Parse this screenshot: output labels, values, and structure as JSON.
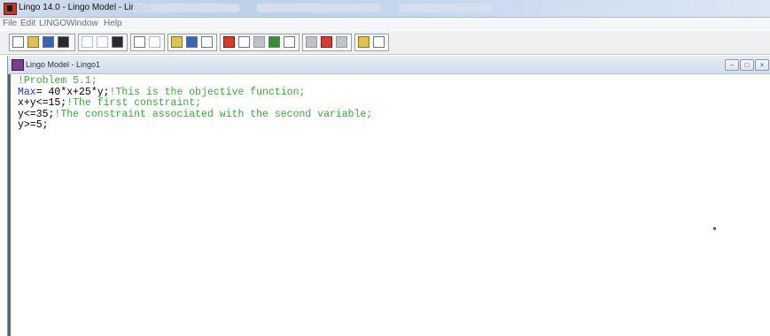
{
  "window": {
    "title": "Lingo 14.0 - Lingo Model - Lingo1"
  },
  "menu": [
    "File",
    "Edit",
    "LINGO",
    "Window",
    "Help"
  ],
  "toolbar": {
    "icons": [
      "new-icon",
      "open-icon",
      "save-icon",
      "print-icon",
      "cut-icon",
      "copy-icon",
      "paste-icon",
      "undo-icon",
      "redo-icon",
      "find-icon",
      "goto-line-icon",
      "match-parenthesis-icon",
      "solve-icon",
      "solution-icon",
      "matrix-picture-icon",
      "close-all-icon",
      "tile-icon",
      "send-to-back-icon",
      "options-icon",
      "help-topics-icon",
      "context-help-icon"
    ]
  },
  "document": {
    "title": "Lingo Model - Lingo1",
    "lines": [
      {
        "code": "",
        "keyword": "",
        "comment": "!Problem 5.1;"
      },
      {
        "code": "",
        "keyword": "Max",
        "rest": "= 40*x+25*y;",
        "comment": "!This is the objective function;"
      },
      {
        "code": "x+y<=15;",
        "keyword": "",
        "comment": "!The first constraint;"
      },
      {
        "code": "y<=35;",
        "keyword": "",
        "comment": "!The constraint associated with the second variable;"
      },
      {
        "code": "y>=5;",
        "keyword": "",
        "comment": ""
      }
    ]
  },
  "colors": {
    "keyword": "#2b2bd6",
    "comment": "#3ea63e",
    "text": "#000000",
    "titlebar": "#bcd0e8"
  }
}
